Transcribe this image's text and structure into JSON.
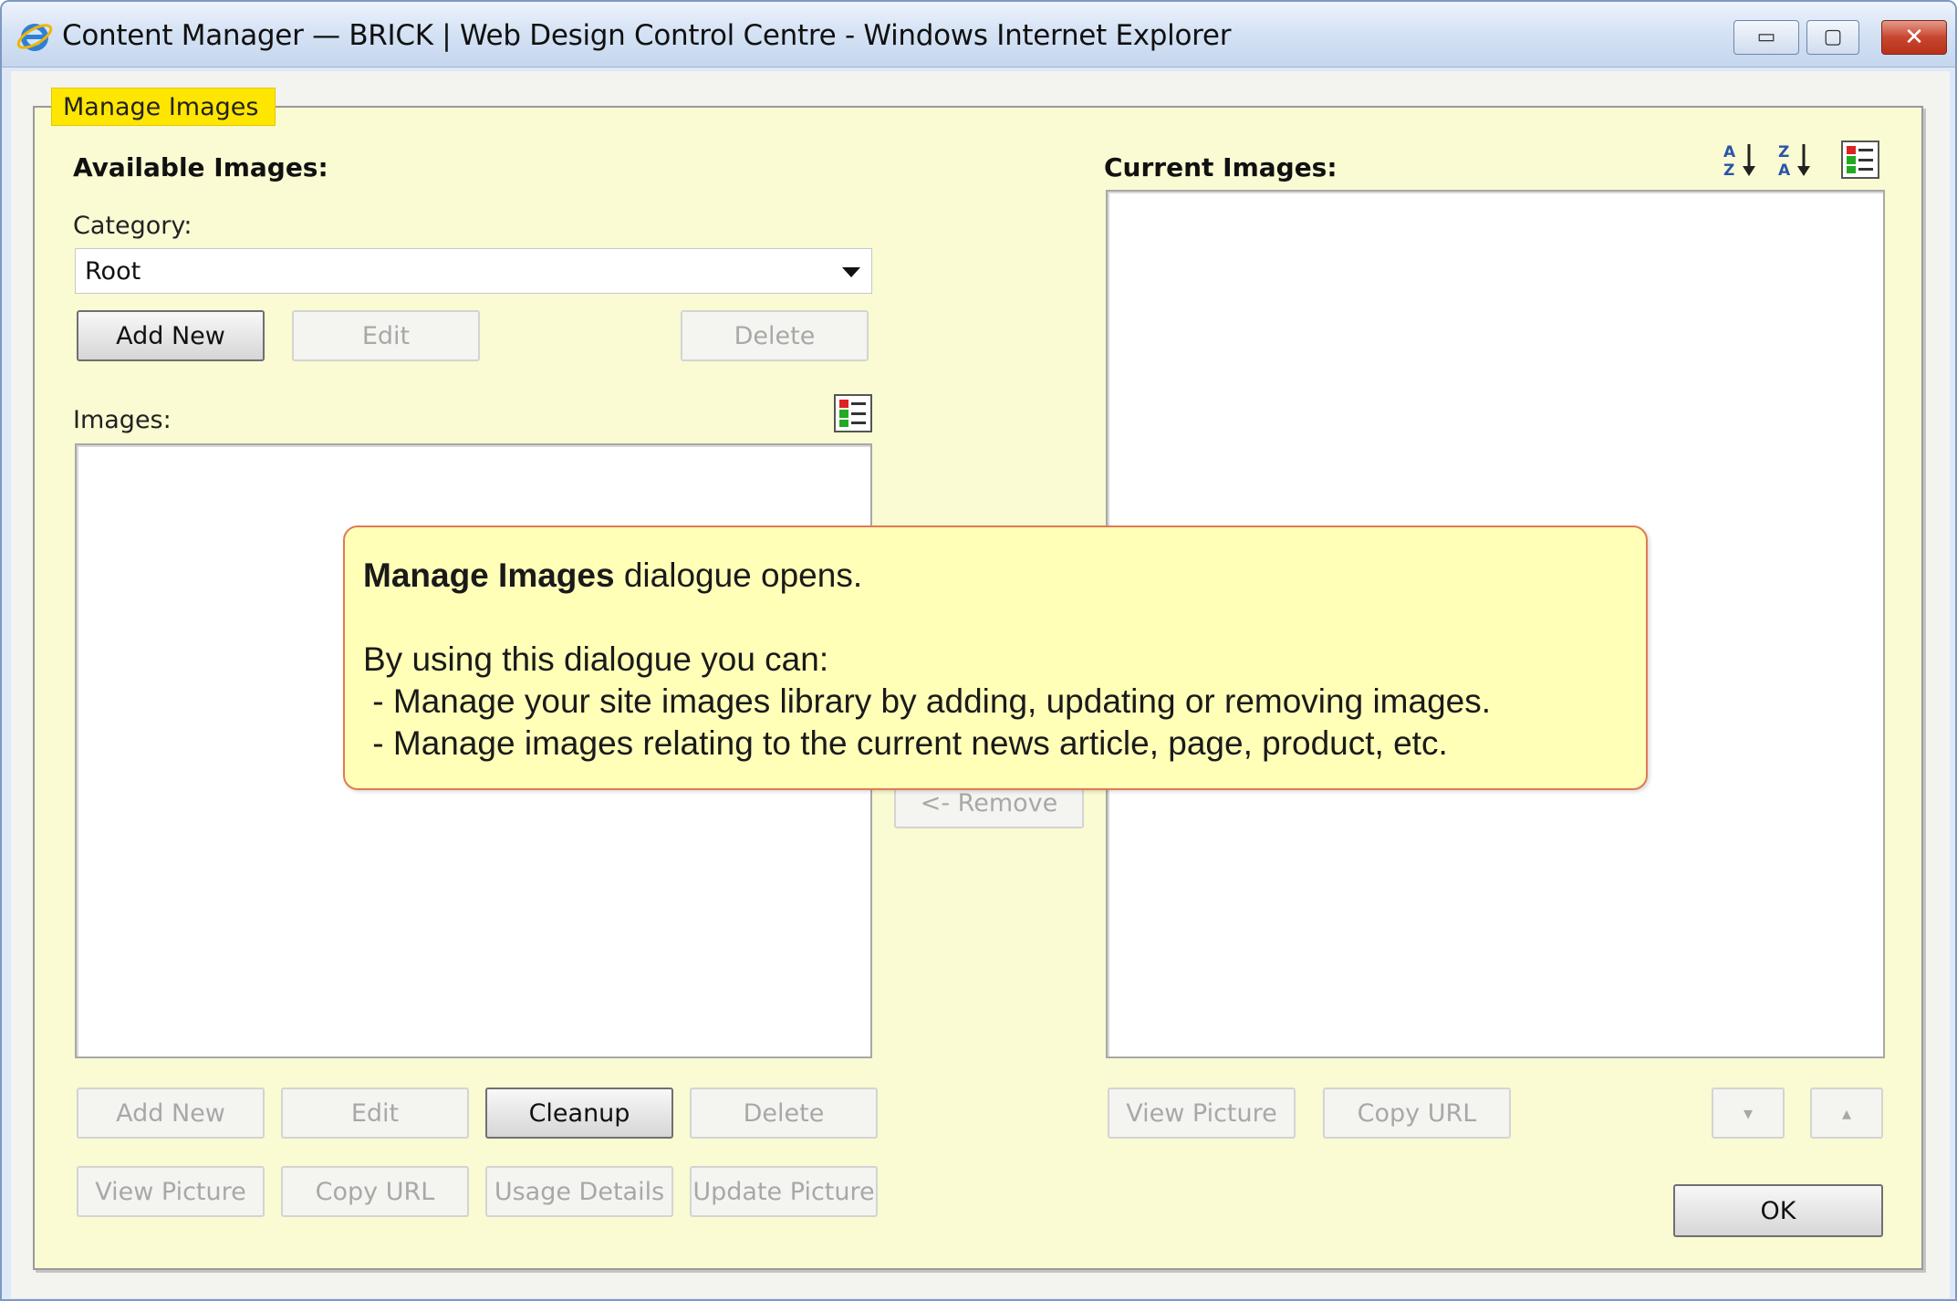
{
  "window": {
    "title": "Content Manager — BRICK | Web Design Control Centre - Windows Internet Explorer",
    "app_icon": "internet-explorer-icon",
    "controls": {
      "minimize": "minimize-icon",
      "maximize": "maximize-icon",
      "close": "close-icon"
    }
  },
  "dialog": {
    "legend": "Manage Images",
    "available": {
      "heading": "Available Images:",
      "category_label": "Category:",
      "category_value": "Root",
      "category_buttons": {
        "add_new": "Add New",
        "edit": "Edit",
        "delete": "Delete"
      },
      "images_label": "Images:",
      "list_view_icon": "list-view-icon",
      "row1": {
        "add_new": "Add New",
        "edit": "Edit",
        "cleanup": "Cleanup",
        "delete": "Delete"
      },
      "row2": {
        "view_picture": "View Picture",
        "copy_url": "Copy URL",
        "usage_details": "Usage Details",
        "update_picture": "Update Picture"
      }
    },
    "middle": {
      "remove": "<- Remove"
    },
    "current": {
      "heading": "Current Images:",
      "sort_asc_icon": "sort-a-z-icon",
      "sort_desc_icon": "sort-z-a-icon",
      "list_view_icon": "list-view-icon",
      "buttons": {
        "view_picture": "View Picture",
        "copy_url": "Copy URL",
        "move_down": "▾",
        "move_up": "▴"
      },
      "ok": "OK"
    }
  },
  "callout": {
    "title_bold": "Manage Images",
    "title_rest": " dialogue opens.",
    "intro": "By using this dialogue you can:",
    "bullets": [
      " - Manage your site images library by adding, updating or removing images.",
      " - Manage images relating to the current news article, page, product, etc."
    ]
  },
  "colors": {
    "panel_bg": "#fafad3",
    "legend_bg": "#ffe600",
    "callout_bg": "#ffffb8",
    "callout_border": "#e07a55",
    "titlebar": "#d6e3f5"
  }
}
